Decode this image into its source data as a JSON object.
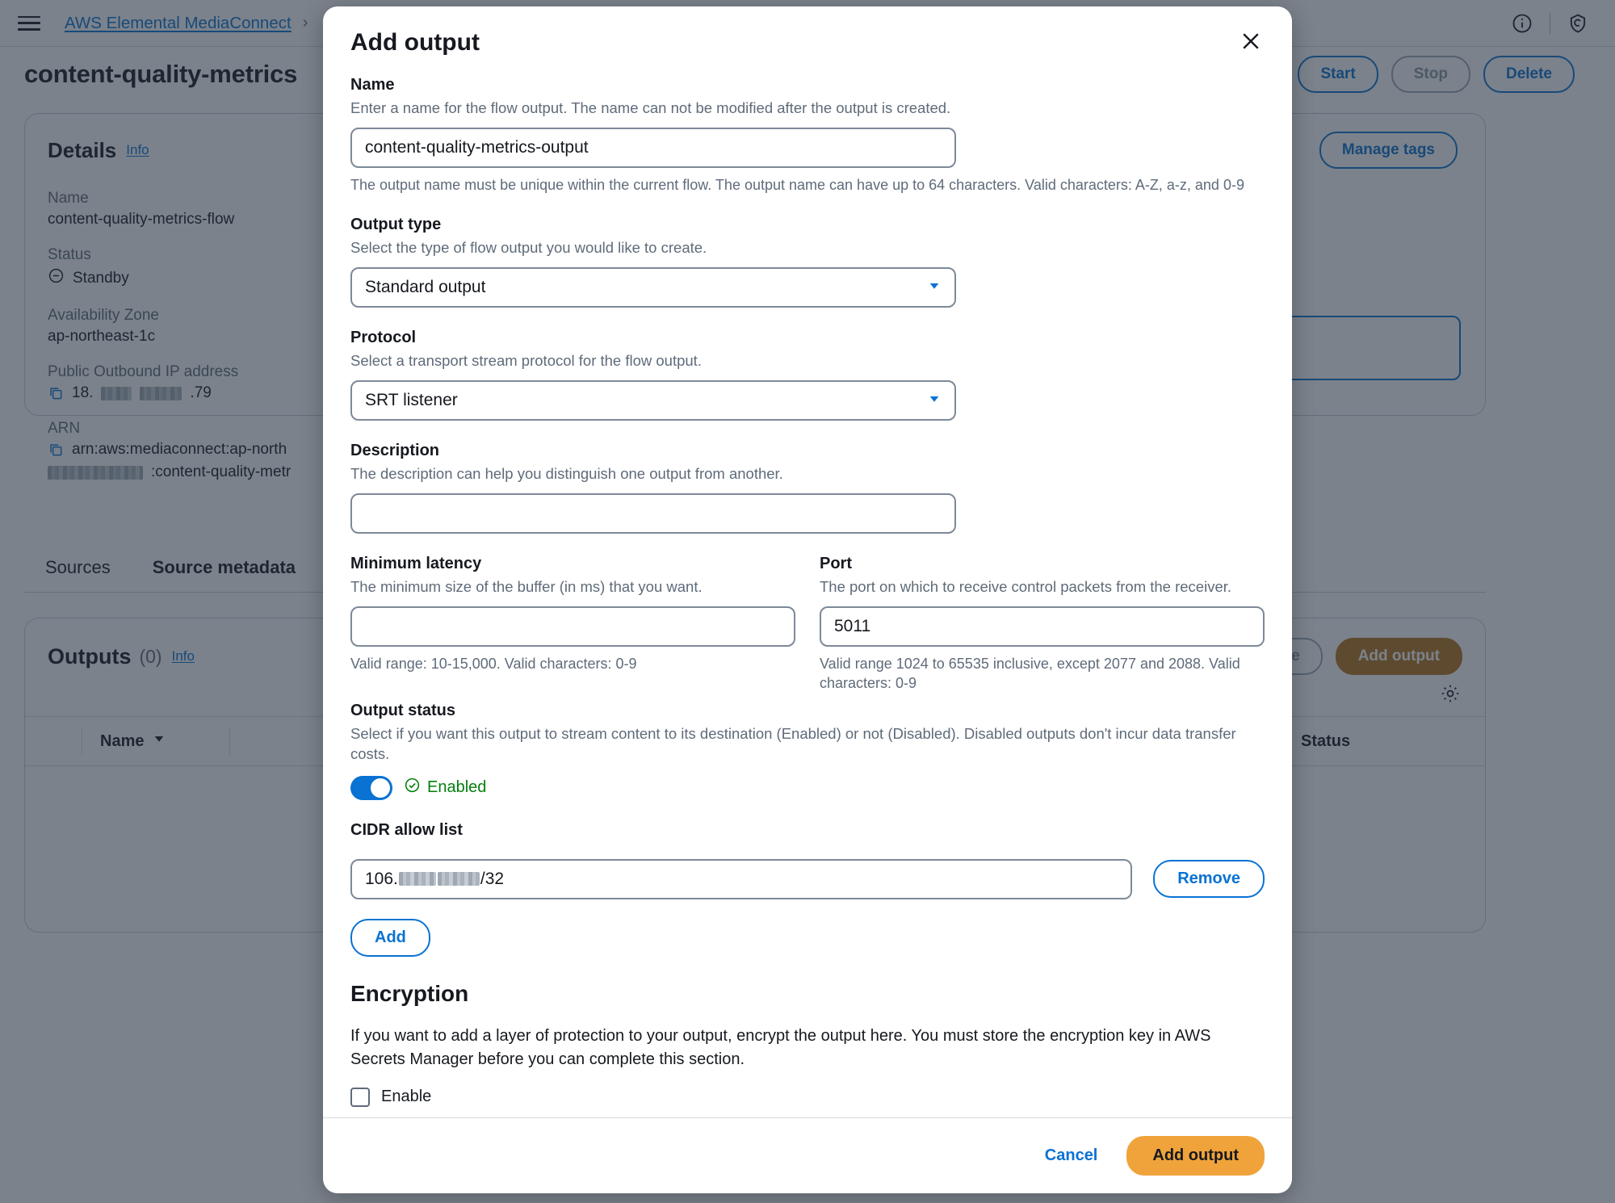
{
  "topbar": {
    "menu_icon": "hamburger-icon",
    "breadcrumb_link": "AWS Elemental MediaConnect",
    "breadcrumb_separator": "›",
    "info_icon": "info-circle-icon",
    "notifications_icon": "bell-shield-icon"
  },
  "page": {
    "title": "content-quality-metrics",
    "actions": {
      "start": "Start",
      "stop": "Stop",
      "delete": "Delete",
      "manage_tags": "Manage tags"
    }
  },
  "details": {
    "title": "Details",
    "info_label": "Info",
    "fields": [
      {
        "label": "Name",
        "value": "content-quality-metrics-flow"
      },
      {
        "label": "Status",
        "value": "Standby"
      },
      {
        "label": "Availability Zone",
        "value": "ap-northeast-1c"
      },
      {
        "label": "Public Outbound IP address",
        "value_prefix": "18.",
        "value_suffix": ".79",
        "redacted": true
      },
      {
        "label": "ARN",
        "value_line1": "arn:aws:mediaconnect:ap-north",
        "value_line2_suffix": ":content-quality-metr",
        "redacted": true
      }
    ]
  },
  "tabs": [
    {
      "label": "Sources"
    },
    {
      "label": "Source metadata"
    }
  ],
  "outputs": {
    "title": "Outputs",
    "count": "(0)",
    "info_label": "Info",
    "remove_label": "Remove",
    "add_output_label": "Add output",
    "settings_icon": "gear-icon",
    "columns": [
      "Name",
      "Status"
    ],
    "sort_icon": "sort-descending-icon"
  },
  "modal": {
    "title": "Add output",
    "close_icon": "close-x-icon",
    "name": {
      "label": "Name",
      "description": "Enter a name for the flow output. The name can not be modified after the output is created.",
      "value": "content-quality-metrics-output",
      "placeholder": "",
      "hint": "The output name must be unique within the current flow. The output name can have up to 64 characters. Valid characters: A-Z, a-z, and 0-9"
    },
    "output_type": {
      "label": "Output type",
      "description": "Select the type of flow output you would like to create.",
      "value": "Standard output",
      "caret_icon": "chevron-down-icon"
    },
    "protocol": {
      "label": "Protocol",
      "description": "Select a transport stream protocol for the flow output.",
      "value": "SRT listener",
      "caret_icon": "chevron-down-icon"
    },
    "description": {
      "label": "Description",
      "description": "The description can help you distinguish one output from another.",
      "value": "",
      "placeholder": ""
    },
    "minimum_latency": {
      "label": "Minimum latency",
      "description": "The minimum size of the buffer (in ms) that you want.",
      "value": "",
      "placeholder": "",
      "hint": "Valid range: 10-15,000. Valid characters: 0-9"
    },
    "port": {
      "label": "Port",
      "description": "The port on which to receive control packets from the receiver.",
      "value": "5011",
      "placeholder": "",
      "hint": "Valid range 1024 to 65535 inclusive, except 2077 and 2088. Valid characters: 0-9"
    },
    "output_status": {
      "label": "Output status",
      "description": "Select if you want this output to stream content to its destination (Enabled) or not (Disabled). Disabled outputs don't incur data transfer costs.",
      "toggle_state": "Enabled",
      "status_icon": "check-circle-icon"
    },
    "cidr_allow_list": {
      "label": "CIDR allow list",
      "value_prefix": "106.",
      "value_suffix": "/32",
      "remove_label": "Remove",
      "add_label": "Add"
    },
    "encryption": {
      "heading": "Encryption",
      "paragraph": "If you want to add a layer of protection to your output, encrypt the output here. You must store the encryption key in AWS Secrets Manager before you can complete this section.",
      "enable_label": "Enable",
      "enabled": false
    },
    "footer": {
      "cancel": "Cancel",
      "submit": "Add output"
    }
  },
  "colors": {
    "link_blue": "#0972d3",
    "accent_orange": "#f0a33a",
    "success_green": "#037f0c",
    "text_dark": "#16191f",
    "text_muted": "#5f6b7a",
    "scrim": "rgba(35,47,62,0.60)"
  }
}
